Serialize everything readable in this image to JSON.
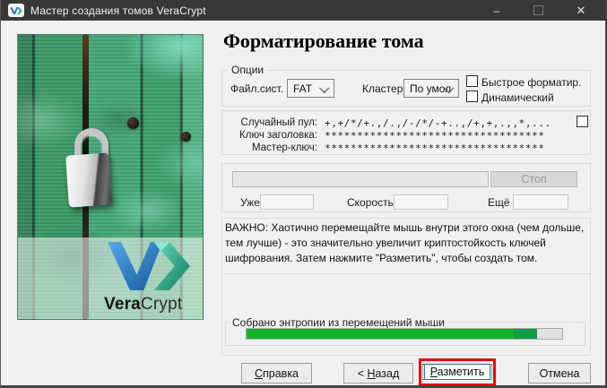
{
  "window": {
    "title": "Мастер создания томов VeraCrypt",
    "controls": {
      "minimize": "–",
      "close": "✕"
    }
  },
  "page": {
    "title": "Форматирование тома"
  },
  "options": {
    "group_label": "Опции",
    "filesystem_label": "Файл.сист.",
    "filesystem_value": "FAT",
    "cluster_label": "Кластер",
    "cluster_value": "По умол",
    "quick_format_label": "Быстрое форматир.",
    "dynamic_label": "Динамический"
  },
  "random_pool": {
    "pool_label": "Случайный пул:",
    "pool_value": "+,+/*/+.,/.,/-/*/-+..,/+,+,.,,*,...",
    "header_key_label": "Ключ заголовка:",
    "header_key_value": "**********************************",
    "master_key_label": "Мастер-ключ:",
    "master_key_value": "**********************************"
  },
  "progress": {
    "stop_label": "Стоп",
    "done_label": "Уже",
    "done_value": "",
    "speed_label": "Скорость",
    "speed_value": "",
    "left_label": "Ещё",
    "left_value": ""
  },
  "notice_text": "ВАЖНО: Хаотично перемещайте мышь внутри этого окна (чем дольше, тем лучше) - это значительно увеличит криптостойкость ключей шифрования. Затем нажмите \"Разметить\", чтобы создать том.",
  "entropy": {
    "group_label": "Собрано энтропии из перемещений мыши",
    "percent": 92
  },
  "footer": {
    "help": {
      "accel": "С",
      "rest": "правка"
    },
    "back": {
      "prefix": "< ",
      "accel": "Н",
      "rest": "азад"
    },
    "format": {
      "accel": "Р",
      "rest": "азметить"
    },
    "cancel": {
      "label": "Отмена"
    }
  },
  "branding": {
    "logo_bold": "Vera",
    "logo_light": "Crypt"
  },
  "colors": {
    "titlebar_bg": "#383838",
    "dialog_bg": "#f0f0f0",
    "entropy_green": "#15b32b",
    "annotation_red": "#e30505",
    "logo_blue": "#2f7cc4",
    "logo_green": "#2aa98c"
  }
}
